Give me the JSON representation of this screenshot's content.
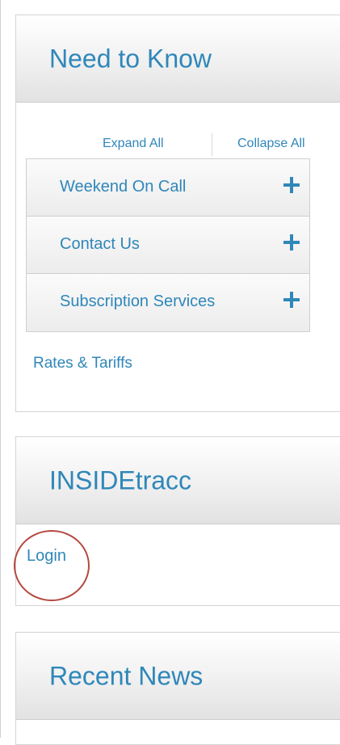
{
  "need_to_know": {
    "title": "Need to Know",
    "expand_all": "Expand All",
    "collapse_all": "Collapse All",
    "items": [
      {
        "label": "Weekend On Call",
        "icon": "plus-icon"
      },
      {
        "label": "Contact Us",
        "icon": "plus-icon"
      },
      {
        "label": "Subscription Services",
        "icon": "plus-icon"
      }
    ],
    "rates_link": "Rates & Tariffs"
  },
  "insidetracc": {
    "title": "INSIDEtracc",
    "login_link": "Login"
  },
  "recent_news": {
    "title": "Recent News"
  },
  "colors": {
    "link": "#2f87b9",
    "annotation_circle": "#b5493f"
  }
}
